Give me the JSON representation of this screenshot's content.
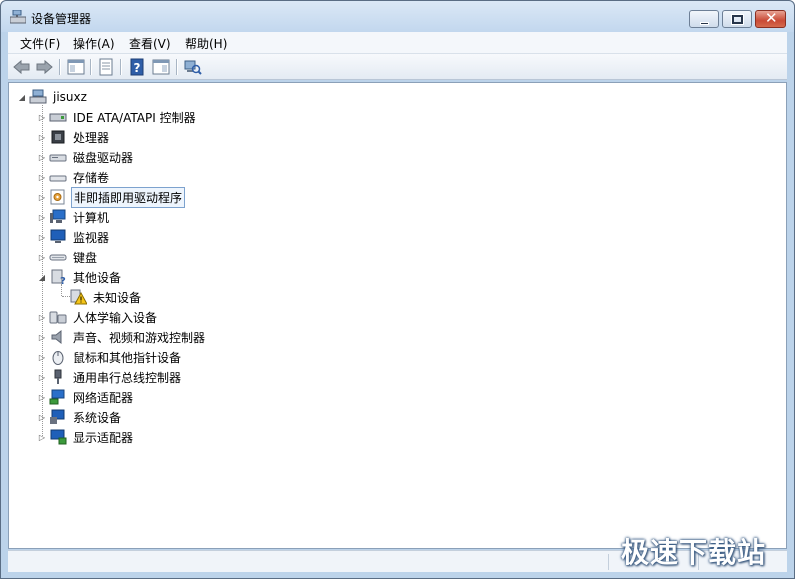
{
  "window": {
    "title": "设备管理器",
    "app_icon": "device-manager-icon"
  },
  "window_controls": {
    "minimize_icon": "minimize-icon",
    "maximize_icon": "maximize-icon",
    "close_glyph": "✕"
  },
  "menubar": {
    "items": [
      {
        "label": "文件(F)"
      },
      {
        "label": "操作(A)"
      },
      {
        "label": "查看(V)"
      },
      {
        "label": "帮助(H)"
      }
    ]
  },
  "toolbar": {
    "buttons": [
      "back-icon",
      "forward-icon",
      "show-hide-tree-icon",
      "properties-icon",
      "help-icon",
      "view-icon",
      "scan-hardware-icon"
    ]
  },
  "tree": {
    "root": {
      "label": "jisuxz",
      "expanded": true,
      "icon": "computer-root-icon"
    },
    "items": [
      {
        "label": "IDE ATA/ATAPI 控制器",
        "icon": "ide-controller-icon",
        "expanded": false,
        "selected": false
      },
      {
        "label": "处理器",
        "icon": "processor-icon",
        "expanded": false,
        "selected": false
      },
      {
        "label": "磁盘驱动器",
        "icon": "disk-drive-icon",
        "expanded": false,
        "selected": false
      },
      {
        "label": "存储卷",
        "icon": "storage-volume-icon",
        "expanded": false,
        "selected": false
      },
      {
        "label": "非即插即用驱动程序",
        "icon": "non-pnp-driver-icon",
        "expanded": false,
        "selected": true
      },
      {
        "label": "计算机",
        "icon": "computer-icon",
        "expanded": false,
        "selected": false
      },
      {
        "label": "监视器",
        "icon": "monitor-icon",
        "expanded": false,
        "selected": false
      },
      {
        "label": "键盘",
        "icon": "keyboard-icon",
        "expanded": false,
        "selected": false
      },
      {
        "label": "其他设备",
        "icon": "other-devices-icon",
        "expanded": true,
        "selected": false,
        "children": [
          {
            "label": "未知设备",
            "icon": "unknown-device-warning-icon"
          }
        ]
      },
      {
        "label": "人体学输入设备",
        "icon": "hid-icon",
        "expanded": false,
        "selected": false
      },
      {
        "label": "声音、视频和游戏控制器",
        "icon": "sound-icon",
        "expanded": false,
        "selected": false
      },
      {
        "label": "鼠标和其他指针设备",
        "icon": "mouse-icon",
        "expanded": false,
        "selected": false
      },
      {
        "label": "通用串行总线控制器",
        "icon": "usb-icon",
        "expanded": false,
        "selected": false
      },
      {
        "label": "网络适配器",
        "icon": "network-adapter-icon",
        "expanded": false,
        "selected": false
      },
      {
        "label": "系统设备",
        "icon": "system-device-icon",
        "expanded": false,
        "selected": false
      },
      {
        "label": "显示适配器",
        "icon": "display-adapter-icon",
        "expanded": false,
        "selected": false
      }
    ]
  },
  "watermark": "极速下载站"
}
